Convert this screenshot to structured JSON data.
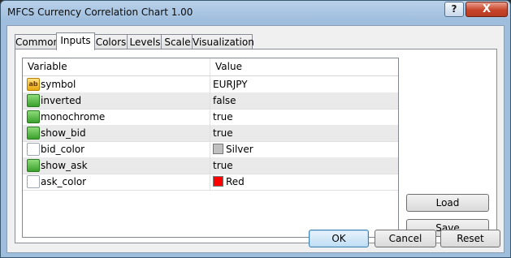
{
  "window": {
    "title": "MFCS Currency Correlation Chart 1.00",
    "help_label": "?",
    "close_label": "X"
  },
  "tabs": [
    {
      "label": "Common",
      "active": false
    },
    {
      "label": "Inputs",
      "active": true
    },
    {
      "label": "Colors",
      "active": false
    },
    {
      "label": "Levels",
      "active": false
    },
    {
      "label": "Scale",
      "active": false
    },
    {
      "label": "Visualization",
      "active": false
    }
  ],
  "grid": {
    "col_variable": "Variable",
    "col_value": "Value",
    "rows": [
      {
        "icon": "string-icon",
        "icon_text": "ab",
        "name": "symbol",
        "value": "EURJPY"
      },
      {
        "icon": "bool-icon",
        "name": "inverted",
        "value": "false"
      },
      {
        "icon": "bool-icon",
        "name": "monochrome",
        "value": "true"
      },
      {
        "icon": "bool-icon",
        "name": "show_bid",
        "value": "true"
      },
      {
        "icon": "color-icon",
        "name": "bid_color",
        "value": "Silver",
        "swatch": "#c0c0c0"
      },
      {
        "icon": "bool-icon",
        "name": "show_ask",
        "value": "true"
      },
      {
        "icon": "color-icon",
        "name": "ask_color",
        "value": "Red",
        "swatch": "#ff0000"
      }
    ]
  },
  "side_buttons": {
    "load_label": "Load",
    "save_label": "Save"
  },
  "bottom_buttons": {
    "ok_label": "OK",
    "cancel_label": "Cancel",
    "reset_label": "Reset"
  }
}
